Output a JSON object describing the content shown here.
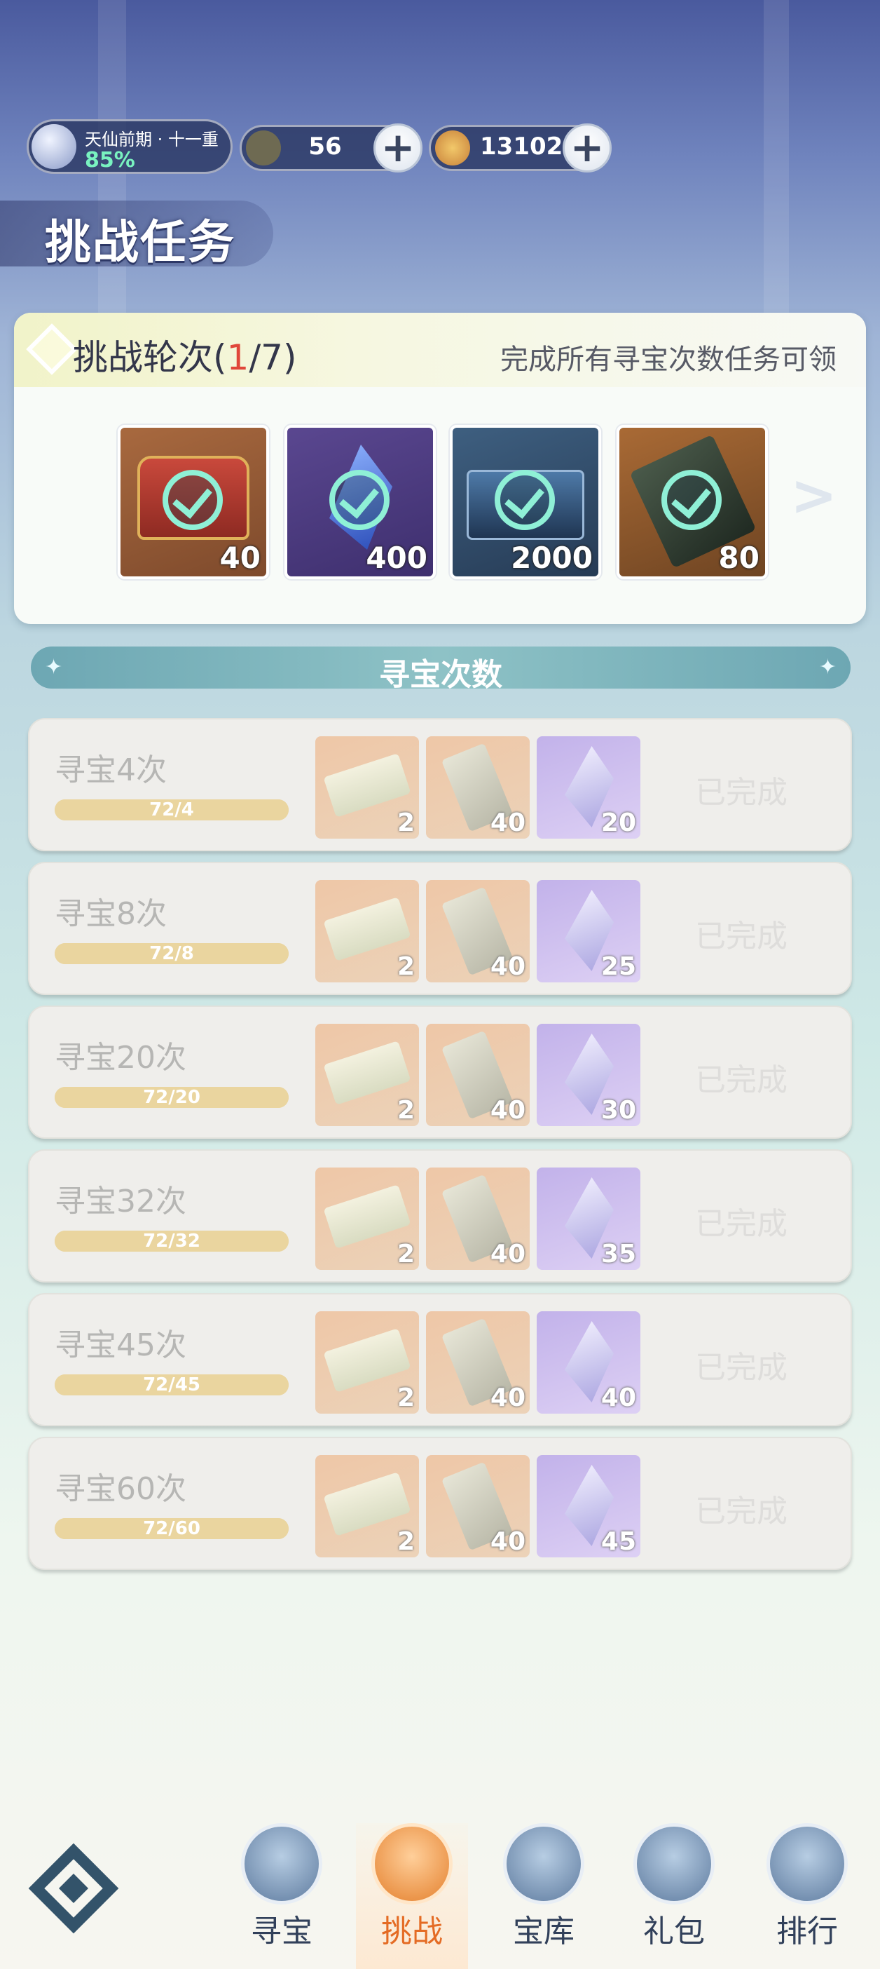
{
  "status_bar": {
    "rank_name": "天仙前期 · 十一重",
    "rank_progress": "85%",
    "currency_1": "56",
    "currency_2": "13102",
    "plus_label": "+"
  },
  "page_title": "挑战任务",
  "rounds": {
    "title_prefix": "挑战轮次(",
    "current": "1",
    "sep_total": "/7)",
    "hint": "完成所有寻宝次数任务可领",
    "rewards": [
      {
        "icon": "treasure-chest-icon",
        "qty": "40",
        "claimed": true,
        "bg": "#8a5a35"
      },
      {
        "icon": "blue-crystal-icon",
        "qty": "400",
        "claimed": true,
        "bg": "#4d3c7e"
      },
      {
        "icon": "blue-box-icon",
        "qty": "2000",
        "claimed": true,
        "bg": "#2f4a66"
      },
      {
        "icon": "token-icon",
        "qty": "80",
        "claimed": true,
        "bg": "#7a4a25"
      }
    ],
    "next_label": ">"
  },
  "section": {
    "title": "寻宝次数"
  },
  "tasks": [
    {
      "title": "寻宝4次",
      "progress": "72/4",
      "fill": 1.0,
      "items": [
        "2",
        "40",
        "20"
      ],
      "status": "已完成"
    },
    {
      "title": "寻宝8次",
      "progress": "72/8",
      "fill": 1.0,
      "items": [
        "2",
        "40",
        "25"
      ],
      "status": "已完成"
    },
    {
      "title": "寻宝20次",
      "progress": "72/20",
      "fill": 1.0,
      "items": [
        "2",
        "40",
        "30"
      ],
      "status": "已完成"
    },
    {
      "title": "寻宝32次",
      "progress": "72/32",
      "fill": 1.0,
      "items": [
        "2",
        "40",
        "35"
      ],
      "status": "已完成"
    },
    {
      "title": "寻宝45次",
      "progress": "72/45",
      "fill": 1.0,
      "items": [
        "2",
        "40",
        "40"
      ],
      "status": "已完成"
    },
    {
      "title": "寻宝60次",
      "progress": "72/60",
      "fill": 1.0,
      "items": [
        "2",
        "40",
        "45"
      ],
      "status": "已完成"
    }
  ],
  "nav": {
    "items": [
      {
        "label": "寻宝",
        "icon": "treasure-bag-icon",
        "active": false
      },
      {
        "label": "挑战",
        "icon": "scroll-icon",
        "active": true
      },
      {
        "label": "宝库",
        "icon": "vault-icon",
        "active": false
      },
      {
        "label": "礼包",
        "icon": "gift-pavilion-icon",
        "active": false
      },
      {
        "label": "排行",
        "icon": "ranking-tower-icon",
        "active": false
      }
    ]
  }
}
